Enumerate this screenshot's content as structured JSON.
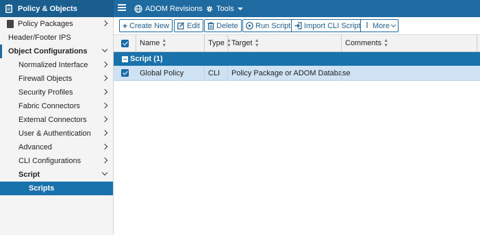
{
  "topbar": {
    "title": "Policy & Objects",
    "adom_revisions": "ADOM Revisions",
    "tools": "Tools"
  },
  "sidebar": {
    "items": [
      {
        "label": "Policy Packages"
      },
      {
        "label": "Header/Footer IPS"
      },
      {
        "label": "Object Configurations"
      },
      {
        "label": "Normalized Interface"
      },
      {
        "label": "Firewall Objects"
      },
      {
        "label": "Security Profiles"
      },
      {
        "label": "Fabric Connectors"
      },
      {
        "label": "External Connectors"
      },
      {
        "label": "User & Authentication"
      },
      {
        "label": "Advanced"
      },
      {
        "label": "CLI Configurations"
      },
      {
        "label": "Script"
      },
      {
        "label": "Scripts"
      }
    ]
  },
  "toolbar": {
    "create_new": "Create New",
    "edit": "Edit",
    "delete": "Delete",
    "run_script": "Run Script",
    "import_cli_script": "Import CLI Script",
    "more": "More"
  },
  "table": {
    "columns": [
      "Name",
      "Type",
      "Target",
      "Comments"
    ],
    "group_label": "Script (1)",
    "rows": [
      {
        "name": "Global Policy",
        "type": "CLI",
        "target": "Policy Package or ADOM Database",
        "comments": ""
      }
    ]
  },
  "colors": {
    "brand_blue": "#1f6aa0",
    "selected_row": "#cfe2f3",
    "active_nav": "#1a72ac"
  }
}
